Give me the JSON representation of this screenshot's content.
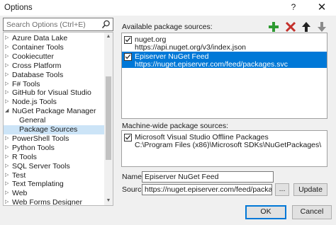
{
  "window": {
    "title": "Options",
    "help_label": "?",
    "close_label": "✕"
  },
  "search": {
    "placeholder": "Search Options (Ctrl+E)"
  },
  "tree": {
    "items": [
      {
        "label": "Azure Data Lake",
        "arrow": "▷",
        "child": false,
        "selected": false
      },
      {
        "label": "Container Tools",
        "arrow": "▷",
        "child": false,
        "selected": false
      },
      {
        "label": "Cookiecutter",
        "arrow": "▷",
        "child": false,
        "selected": false
      },
      {
        "label": "Cross Platform",
        "arrow": "▷",
        "child": false,
        "selected": false
      },
      {
        "label": "Database Tools",
        "arrow": "▷",
        "child": false,
        "selected": false
      },
      {
        "label": "F# Tools",
        "arrow": "▷",
        "child": false,
        "selected": false
      },
      {
        "label": "GitHub for Visual Studio",
        "arrow": "▷",
        "child": false,
        "selected": false
      },
      {
        "label": "Node.js Tools",
        "arrow": "▷",
        "child": false,
        "selected": false
      },
      {
        "label": "NuGet Package Manager",
        "arrow": "◢",
        "child": false,
        "selected": false
      },
      {
        "label": "General",
        "arrow": "",
        "child": true,
        "selected": false
      },
      {
        "label": "Package Sources",
        "arrow": "",
        "child": true,
        "selected": true
      },
      {
        "label": "PowerShell Tools",
        "arrow": "▷",
        "child": false,
        "selected": false
      },
      {
        "label": "Python Tools",
        "arrow": "▷",
        "child": false,
        "selected": false
      },
      {
        "label": "R Tools",
        "arrow": "▷",
        "child": false,
        "selected": false
      },
      {
        "label": "SQL Server Tools",
        "arrow": "▷",
        "child": false,
        "selected": false
      },
      {
        "label": "Test",
        "arrow": "▷",
        "child": false,
        "selected": false
      },
      {
        "label": "Text Templating",
        "arrow": "▷",
        "child": false,
        "selected": false
      },
      {
        "label": "Web",
        "arrow": "▷",
        "child": false,
        "selected": false
      },
      {
        "label": "Web Forms Designer",
        "arrow": "▷",
        "child": false,
        "selected": false
      }
    ]
  },
  "available": {
    "label": "Available package sources:",
    "sources": [
      {
        "name": "nuget.org",
        "url": "https://api.nuget.org/v3/index.json",
        "checked": true,
        "selected": false
      },
      {
        "name": "Episerver NuGet Feed",
        "url": "https://nuget.episerver.com/feed/packages.svc",
        "checked": true,
        "selected": true
      }
    ]
  },
  "machine_wide": {
    "label": "Machine-wide package sources:",
    "sources": [
      {
        "name": "Microsoft Visual Studio Offline Packages",
        "url": "C:\\Program Files (x86)\\Microsoft SDKs\\NuGetPackages\\",
        "checked": true
      }
    ]
  },
  "form": {
    "name_label": "Name:",
    "name_value": "Episerver NuGet Feed",
    "source_label": "Source:",
    "source_value": "https://nuget.episerver.com/feed/packages.svc",
    "browse_label": "...",
    "update_label": "Update"
  },
  "footer": {
    "ok_label": "OK",
    "cancel_label": "Cancel"
  },
  "colors": {
    "add": "#2e9a31",
    "remove": "#c4302b",
    "selection": "#0078d7"
  },
  "icons": {
    "add": "plus-icon",
    "remove": "x-icon",
    "up": "arrow-up-icon",
    "down": "arrow-down-icon"
  }
}
